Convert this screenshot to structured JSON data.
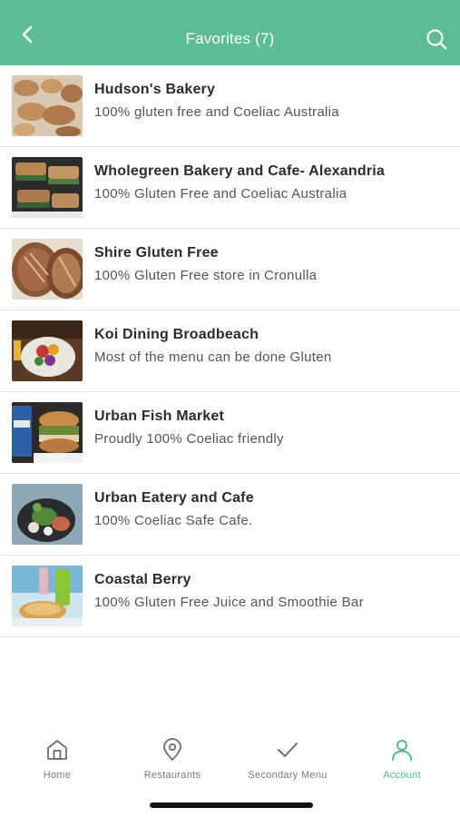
{
  "header": {
    "title": "Favorites (7)",
    "back_icon": "chevron-left-icon",
    "search_icon": "search-icon",
    "background": "#5dbb96"
  },
  "favorites": [
    {
      "name": "Hudson's Bakery",
      "description": "100% gluten free and Coeliac Australia"
    },
    {
      "name": "Wholegreen Bakery and Cafe- Alexandria",
      "description": "100% Gluten Free and Coeliac Australia"
    },
    {
      "name": "Shire Gluten Free",
      "description": "100% Gluten Free store in Cronulla"
    },
    {
      "name": "Koi Dining Broadbeach",
      "description": "Most of the menu can be done Gluten"
    },
    {
      "name": "Urban Fish Market",
      "description": "Proudly 100% Coeliac friendly"
    },
    {
      "name": "Urban Eatery and Cafe",
      "description": "100% Coeliac Safe Cafe."
    },
    {
      "name": "Coastal Berry",
      "description": "100% Gluten Free Juice and Smoothie Bar"
    }
  ],
  "tabbar": {
    "items": [
      {
        "label": "Home",
        "icon": "home-icon",
        "active": false
      },
      {
        "label": "Restaurants",
        "icon": "location-pin-icon",
        "active": false
      },
      {
        "label": "Secondary Menu",
        "icon": "checkmark-icon",
        "active": false
      },
      {
        "label": "Account",
        "icon": "user-icon",
        "active": true
      }
    ],
    "active_color": "#4fb98f",
    "inactive_color": "#7a7a7a"
  }
}
